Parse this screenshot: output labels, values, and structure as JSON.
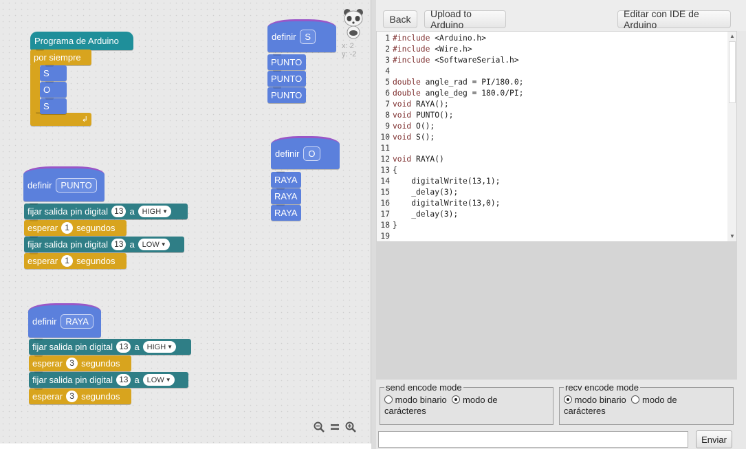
{
  "workspace": {
    "coords": {
      "x": "x: 2",
      "y": "y: -2"
    },
    "main": {
      "title": "Programa de Arduino",
      "loop": "por siempre",
      "calls": [
        "S",
        "O",
        "S"
      ]
    },
    "def_s": {
      "definir": "definir",
      "name": "S",
      "calls": [
        "PUNTO",
        "PUNTO",
        "PUNTO"
      ]
    },
    "def_o": {
      "definir": "definir",
      "name": "O",
      "calls": [
        "RAYA",
        "RAYA",
        "RAYA"
      ]
    },
    "def_punto": {
      "definir": "definir",
      "name": "PUNTO",
      "pin_label": "fijar salida pin digital",
      "pin": "13",
      "a": "a",
      "high": "HIGH",
      "low": "LOW",
      "wait": "esperar",
      "wait_val": "1",
      "unit": "segundos"
    },
    "def_raya": {
      "definir": "definir",
      "name": "RAYA",
      "pin_label": "fijar salida pin digital",
      "pin": "13",
      "a": "a",
      "high": "HIGH",
      "low": "LOW",
      "wait": "esperar",
      "wait_val": "3",
      "unit": "segundos"
    },
    "zoom": {
      "out": "−",
      "reset": "=",
      "in": "+"
    }
  },
  "toolbar": {
    "back": "Back",
    "upload": "Upload to Arduino",
    "ide": "Editar con IDE de Arduino"
  },
  "code": {
    "lines": [
      "#include <Arduino.h>",
      "#include <Wire.h>",
      "#include <SoftwareSerial.h>",
      "",
      "double angle_rad = PI/180.0;",
      "double angle_deg = 180.0/PI;",
      "void RAYA();",
      "void PUNTO();",
      "void O();",
      "void S();",
      "",
      "void RAYA()",
      "{",
      "    digitalWrite(13,1);",
      "    _delay(3);",
      "    digitalWrite(13,0);",
      "    _delay(3);",
      "}",
      ""
    ]
  },
  "serial": {
    "send_legend": "send encode mode",
    "recv_legend": "recv encode mode",
    "binary": "modo binario",
    "chars_a": "modo de",
    "chars_b": "carácteres",
    "send_button": "Enviar"
  }
}
